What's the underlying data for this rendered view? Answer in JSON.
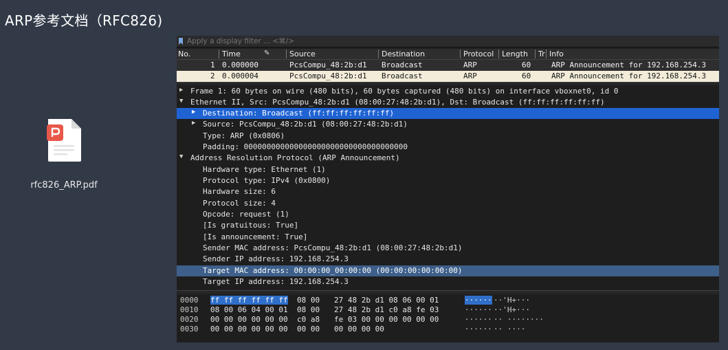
{
  "slide": {
    "title": "ARP参考文档（RFC826)"
  },
  "file": {
    "name": "rfc826_ARP.pdf",
    "icon": "pdf-file-icon",
    "accent": "#e8584a"
  },
  "filter": {
    "placeholder": "Apply a display filter ... <⌘/>"
  },
  "packet_list": {
    "columns": [
      "No.",
      "Time",
      "Source",
      "Destination",
      "Protocol",
      "Length",
      "Tr",
      "Info"
    ],
    "rows": [
      {
        "no": "1",
        "time": "0.000000",
        "source": "PcsCompu_48:2b:d1",
        "destination": "Broadcast",
        "protocol": "ARP",
        "length": "60",
        "info": "ARP Announcement for 192.168.254.3"
      },
      {
        "no": "2",
        "time": "0.000004",
        "source": "PcsCompu_48:2b:d1",
        "destination": "Broadcast",
        "protocol": "ARP",
        "length": "60",
        "info": "ARP Announcement for 192.168.254.3"
      }
    ],
    "selected_row_bg": "#f2ecd9"
  },
  "details": [
    {
      "arrow": "▶",
      "text": "Frame 1: 60 bytes on wire (480 bits), 60 bytes captured (480 bits) on interface vboxnet0, id 0"
    },
    {
      "arrow": "▼",
      "text": "Ethernet II, Src: PcsCompu_48:2b:d1 (08:00:27:48:2b:d1), Dst: Broadcast (ff:ff:ff:ff:ff:ff)"
    },
    {
      "arrow": "▶",
      "text": "Destination: Broadcast (ff:ff:ff:ff:ff:ff)"
    },
    {
      "arrow": "▶",
      "text": "Source: PcsCompu_48:2b:d1 (08:00:27:48:2b:d1)"
    },
    {
      "arrow": "",
      "text": "Type: ARP (0x0806)"
    },
    {
      "arrow": "",
      "text": "Padding: 000000000000000000000000000000000000"
    },
    {
      "arrow": "▼",
      "text": "Address Resolution Protocol (ARP Announcement)"
    },
    {
      "arrow": "",
      "text": "Hardware type: Ethernet (1)"
    },
    {
      "arrow": "",
      "text": "Protocol type: IPv4 (0x0800)"
    },
    {
      "arrow": "",
      "text": "Hardware size: 6"
    },
    {
      "arrow": "",
      "text": "Protocol size: 4"
    },
    {
      "arrow": "",
      "text": "Opcode: request (1)"
    },
    {
      "arrow": "",
      "text": "[Is gratuitous: True]"
    },
    {
      "arrow": "",
      "text": "[Is announcement: True]"
    },
    {
      "arrow": "",
      "text": "Sender MAC address: PcsCompu_48:2b:d1 (08:00:27:48:2b:d1)"
    },
    {
      "arrow": "",
      "text": "Sender IP address: 192.168.254.3"
    },
    {
      "arrow": "",
      "text": "Target MAC address: 00:00:00_00:00:00 (00:00:00:00:00:00)"
    },
    {
      "arrow": "",
      "text": "Target IP address: 192.168.254.3"
    }
  ],
  "hex_dump": [
    {
      "offset": "0000",
      "bytes_a": "ff ff ff ff ff ff",
      "bytes_b": "08 00",
      "bytes_c": "27 48 2b d1 08 06 00 01",
      "ascii_a": "······",
      "ascii_b": "··'H+···"
    },
    {
      "offset": "0010",
      "bytes_a": "08 00 06 04 00 01",
      "bytes_b": "08 00",
      "bytes_c": "27 48 2b d1 c0 a8 fe 03",
      "ascii_a": "······",
      "ascii_b": "··'H+···"
    },
    {
      "offset": "0020",
      "bytes_a": "00 00 00 00 00 00",
      "bytes_b": "c0 a8",
      "bytes_c": "fe 03 00 00 00 00 00 00",
      "ascii_a": "······",
      "ascii_b": "·· ········"
    },
    {
      "offset": "0030",
      "bytes_a": "00 00 00 00 00 00",
      "bytes_b": "00 00",
      "bytes_c": "00 00 00 00",
      "ascii_a": "······",
      "ascii_b": "·· ····"
    }
  ],
  "colors": {
    "selection_blue": "#1f63d3",
    "selection_gray": "#3d5f8a",
    "background": "#323a48"
  }
}
